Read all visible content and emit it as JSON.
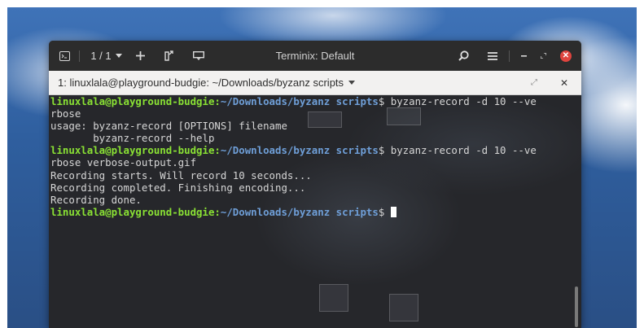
{
  "titlebar": {
    "tab_counter": "1 / 1",
    "title": "Terminix: Default",
    "icons": [
      "terminal-icon",
      "chevron-down-icon",
      "add-icon",
      "detach-icon",
      "sync-input-icon",
      "search-icon",
      "menu-icon",
      "minimize-icon",
      "maximize-icon",
      "close-icon"
    ]
  },
  "tab": {
    "title": "1: linuxlala@playground-budgie: ~/Downloads/byzanz scripts",
    "maximize_glyph": "⤢",
    "close_glyph": "✕"
  },
  "terminal": {
    "user_host": "linuxlala@playground-budgie",
    "path": "~/Downloads/byzanz scripts",
    "lines": [
      {
        "type": "prompt",
        "cmd": "$ byzanz-record -d 10 --ve"
      },
      {
        "type": "output",
        "text": "rbose"
      },
      {
        "type": "output",
        "text": "usage: byzanz-record [OPTIONS] filename"
      },
      {
        "type": "output",
        "text": "       byzanz-record --help"
      },
      {
        "type": "prompt",
        "cmd": "$ byzanz-record -d 10 --ve"
      },
      {
        "type": "output",
        "text": "rbose verbose-output.gif"
      },
      {
        "type": "output",
        "text": "Recording starts. Will record 10 seconds..."
      },
      {
        "type": "output",
        "text": "Recording completed. Finishing encoding..."
      },
      {
        "type": "output",
        "text": "Recording done."
      },
      {
        "type": "prompt",
        "cmd": "$ ",
        "cursor": true
      }
    ]
  }
}
